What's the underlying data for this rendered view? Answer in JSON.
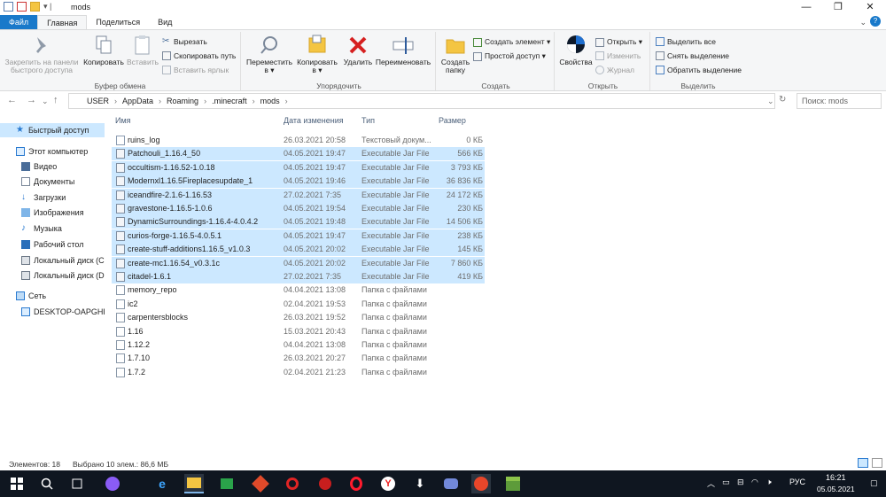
{
  "window": {
    "title": "mods"
  },
  "tabs": [
    "Файл",
    "Главная",
    "Поделиться",
    "Вид"
  ],
  "ribbon": {
    "clipboard": {
      "pin": "Закрепить на панели быстрого доступа",
      "copy": "Копировать",
      "paste": "Вставить",
      "cut": "Вырезать",
      "copy_path": "Скопировать путь",
      "paste_shortcut": "Вставить ярлык",
      "label": "Буфер обмена"
    },
    "organize": {
      "move": "Переместить в ▾",
      "copy_to": "Копировать в ▾",
      "delete": "Удалить",
      "rename": "Переименовать",
      "label": "Упорядочить"
    },
    "new": {
      "new_folder": "Создать папку",
      "new_item": "Создать элемент ▾",
      "easy_access": "Простой доступ ▾",
      "label": "Создать"
    },
    "open": {
      "properties": "Свойства",
      "open": "Открыть ▾",
      "edit": "Изменить",
      "history": "Журнал",
      "label": "Открыть"
    },
    "select": {
      "select_all": "Выделить все",
      "select_none": "Снять выделение",
      "invert": "Обратить выделение",
      "label": "Выделить"
    }
  },
  "address": {
    "crumbs": [
      "USER",
      "AppData",
      "Roaming",
      ".minecraft",
      "mods"
    ],
    "search_placeholder": "Поиск: mods"
  },
  "navpane": {
    "quick_access": "Быстрый доступ",
    "this_pc": "Этот компьютер",
    "items": [
      "Видео",
      "Документы",
      "Загрузки",
      "Изображения",
      "Музыка",
      "Рабочий стол",
      "Локальный диск (C",
      "Локальный диск (D"
    ],
    "network": "Сеть",
    "desktop_pc": "DESKTOP-OAPGHR"
  },
  "columns": {
    "name": "Имя",
    "date": "Дата изменения",
    "type": "Тип",
    "size": "Размер"
  },
  "files": [
    {
      "name": "ruins_log",
      "date": "26.03.2021 20:58",
      "type": "Текстовый докум...",
      "size": "0 КБ",
      "kind": "txt",
      "selected": false
    },
    {
      "name": "Patchouli_1.16.4_50",
      "date": "04.05.2021 19:47",
      "type": "Executable Jar File",
      "size": "566 КБ",
      "kind": "jar",
      "selected": true
    },
    {
      "name": "occultism-1.16.52-1.0.18",
      "date": "04.05.2021 19:47",
      "type": "Executable Jar File",
      "size": "3 793 КБ",
      "kind": "jar",
      "selected": true
    },
    {
      "name": "Modernxl1.16.5Fireplacesupdate_1",
      "date": "04.05.2021 19:46",
      "type": "Executable Jar File",
      "size": "36 836 КБ",
      "kind": "jar",
      "selected": true
    },
    {
      "name": "iceandfire-2.1.6-1.16.53",
      "date": "27.02.2021 7:35",
      "type": "Executable Jar File",
      "size": "24 172 КБ",
      "kind": "jar",
      "selected": true
    },
    {
      "name": "gravestone-1.16.5-1.0.6",
      "date": "04.05.2021 19:54",
      "type": "Executable Jar File",
      "size": "230 КБ",
      "kind": "jar",
      "selected": true
    },
    {
      "name": "DynamicSurroundings-1.16.4-4.0.4.2",
      "date": "04.05.2021 19:48",
      "type": "Executable Jar File",
      "size": "14 506 КБ",
      "kind": "jar",
      "selected": true
    },
    {
      "name": "curios-forge-1.16.5-4.0.5.1",
      "date": "04.05.2021 19:47",
      "type": "Executable Jar File",
      "size": "238 КБ",
      "kind": "jar",
      "selected": true
    },
    {
      "name": "create-stuff-additions1.16.5_v1.0.3",
      "date": "04.05.2021 20:02",
      "type": "Executable Jar File",
      "size": "145 КБ",
      "kind": "jar",
      "selected": true
    },
    {
      "name": "create-mc1.16.54_v0.3.1c",
      "date": "04.05.2021 20:02",
      "type": "Executable Jar File",
      "size": "7 860 КБ",
      "kind": "jar",
      "selected": true
    },
    {
      "name": "citadel-1.6.1",
      "date": "27.02.2021 7:35",
      "type": "Executable Jar File",
      "size": "419 КБ",
      "kind": "jar",
      "selected": true
    },
    {
      "name": "memory_repo",
      "date": "04.04.2021 13:08",
      "type": "Папка с файлами",
      "size": "",
      "kind": "fold",
      "selected": false
    },
    {
      "name": "ic2",
      "date": "02.04.2021 19:53",
      "type": "Папка с файлами",
      "size": "",
      "kind": "fold",
      "selected": false
    },
    {
      "name": "carpentersblocks",
      "date": "26.03.2021 19:52",
      "type": "Папка с файлами",
      "size": "",
      "kind": "fold",
      "selected": false
    },
    {
      "name": "1.16",
      "date": "15.03.2021 20:43",
      "type": "Папка с файлами",
      "size": "",
      "kind": "fold",
      "selected": false
    },
    {
      "name": "1.12.2",
      "date": "04.04.2021 13:08",
      "type": "Папка с файлами",
      "size": "",
      "kind": "fold",
      "selected": false
    },
    {
      "name": "1.7.10",
      "date": "26.03.2021 20:27",
      "type": "Папка с файлами",
      "size": "",
      "kind": "fold",
      "selected": false
    },
    {
      "name": "1.7.2",
      "date": "02.04.2021 21:23",
      "type": "Папка с файлами",
      "size": "",
      "kind": "fold",
      "selected": false
    }
  ],
  "status": {
    "count": "Элементов: 18",
    "selection": "Выбрано 10 элем.: 86,6 МБ"
  },
  "taskbar": {
    "lang": "РУС",
    "time": "16:21",
    "date": "05.05.2021"
  },
  "colors": {
    "accent": "#1979ca",
    "selection": "#cce8ff",
    "taskbar": "#0f1620"
  }
}
